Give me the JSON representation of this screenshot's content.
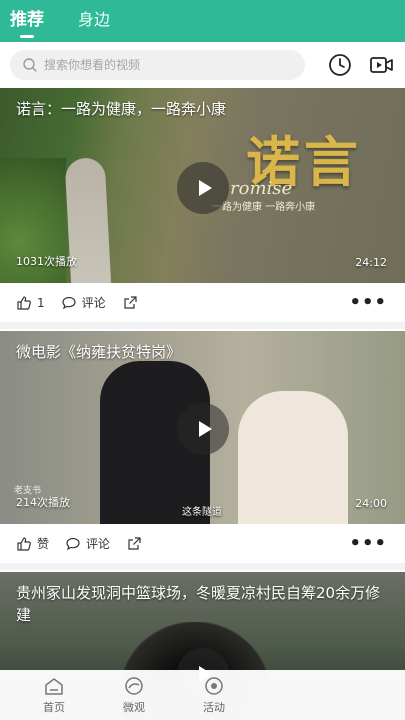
{
  "tabs": [
    {
      "label": "推荐",
      "active": true
    },
    {
      "label": "身边",
      "active": false
    }
  ],
  "search": {
    "placeholder": "搜索你想看的视频"
  },
  "header_icons": [
    "clock-icon",
    "video-camera-icon"
  ],
  "colors": {
    "accent": "#2fb996"
  },
  "feed": [
    {
      "title": "诺言：一路为健康，一路奔小康",
      "plays": "1031次播放",
      "duration": "24:12",
      "overlay_title": "诺言",
      "overlay_word": "romise",
      "overlay_subtitle": "一路为健康  一路奔小康",
      "like_count": "1",
      "comment_label": "评论"
    },
    {
      "title": "微电影《纳雍扶贫特岗》",
      "plays": "214次播放",
      "duration": "24:00",
      "caption": "这条隧道",
      "watermark": "老支书",
      "like_label": "赞",
      "comment_label": "评论"
    },
    {
      "title": "贵州冢山发现洞中篮球场，冬暖夏凉村民自筹20余万修建"
    }
  ],
  "bottom_nav": [
    {
      "label": "首页",
      "icon": "home-icon"
    },
    {
      "label": "微观",
      "icon": "micro-view-icon"
    },
    {
      "label": "活动",
      "icon": "activity-icon"
    }
  ]
}
